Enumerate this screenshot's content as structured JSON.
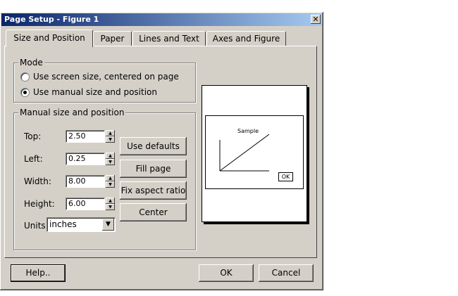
{
  "window": {
    "title": "Page Setup - Figure 1",
    "close_glyph": "✕"
  },
  "tabs": [
    {
      "label": "Size and Position",
      "active": true
    },
    {
      "label": "Paper",
      "active": false
    },
    {
      "label": "Lines and Text",
      "active": false
    },
    {
      "label": "Axes and Figure",
      "active": false
    }
  ],
  "mode": {
    "legend": "Mode",
    "options": [
      {
        "label": "Use screen size, centered on page",
        "selected": false
      },
      {
        "label": "Use manual size and position",
        "selected": true
      }
    ]
  },
  "manual": {
    "legend": "Manual size and position",
    "fields": [
      {
        "label": "Top:",
        "value": "2.50"
      },
      {
        "label": "Left:",
        "value": "0.25"
      },
      {
        "label": "Width:",
        "value": "8.00"
      },
      {
        "label": "Height:",
        "value": "6.00"
      }
    ],
    "units_label": "Units:",
    "units_value": "inches",
    "buttons": {
      "use_defaults": "Use defaults",
      "fill_page": "Fill page",
      "fix_aspect": "Fix aspect ratio",
      "center": "Center"
    }
  },
  "preview": {
    "sample_label": "Sample",
    "ok_label": "OK"
  },
  "footer": {
    "help": "Help..",
    "ok": "OK",
    "cancel": "Cancel"
  },
  "colors": {
    "title_bar_start": "#0a246a",
    "title_bar_end": "#a6caf0",
    "dialog_face": "#d4d0c8"
  }
}
